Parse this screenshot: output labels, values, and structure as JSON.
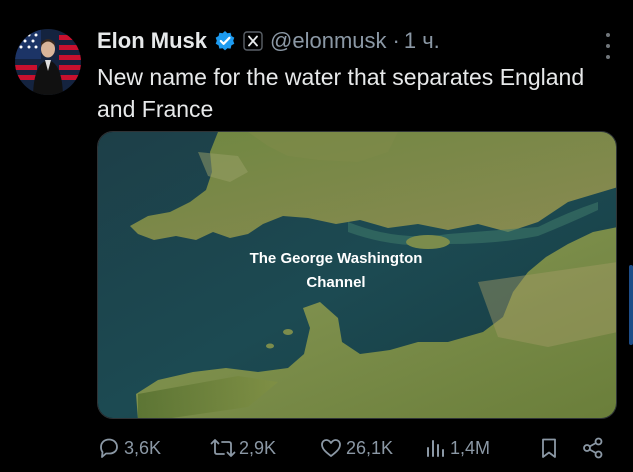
{
  "tweet": {
    "author_name": "Elon Musk",
    "handle": "@elonmusk",
    "separator": "·",
    "time": "1 ч.",
    "text": "New name for the water that separates England and France",
    "image_caption_line1": "The George Washington",
    "image_caption_line2": "Channel"
  },
  "actions": {
    "replies": "3,6K",
    "reposts": "2,9K",
    "likes": "26,1K",
    "views": "1,4M"
  },
  "colors": {
    "background": "#000000",
    "text_primary": "#e7e9ea",
    "text_secondary": "#8b98a5",
    "verified_badge": "#1d9bf0",
    "water": "#1e4a52",
    "land": "#6b7f3e"
  },
  "icons": [
    "avatar",
    "verified-badge-icon",
    "x-affiliation-icon",
    "more-icon",
    "reply-icon",
    "repost-icon",
    "like-icon",
    "views-icon",
    "bookmark-icon",
    "share-icon"
  ]
}
